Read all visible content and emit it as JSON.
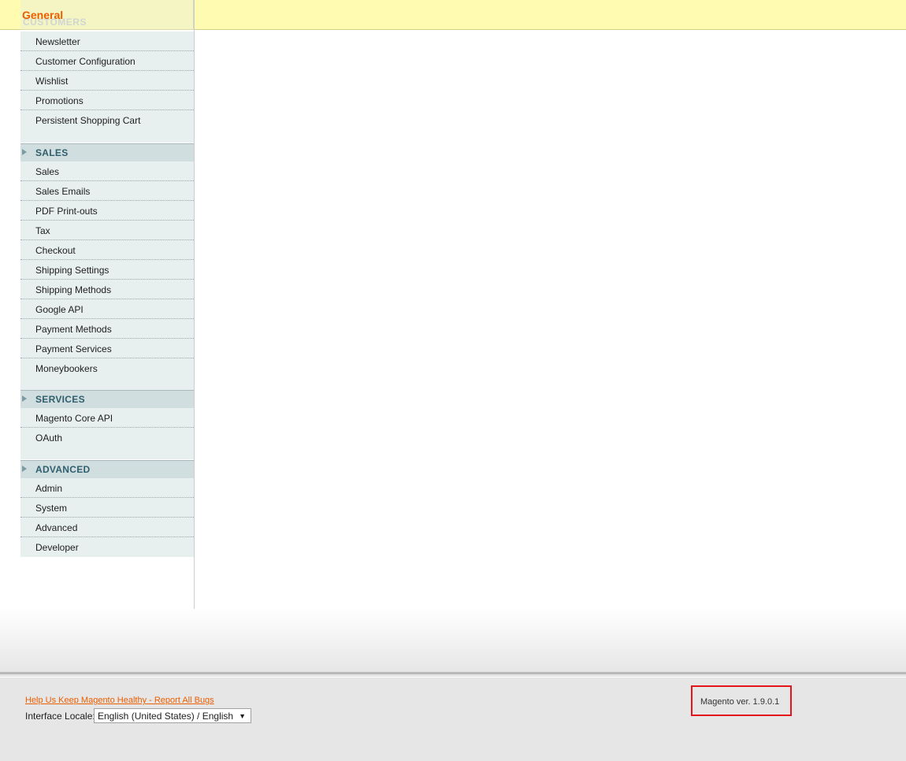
{
  "header": {
    "title": "General"
  },
  "sidebar": {
    "ghost_heading": "CUSTOMERS",
    "customers_items": [
      "Newsletter",
      "Customer Configuration",
      "Wishlist",
      "Promotions",
      "Persistent Shopping Cart"
    ],
    "sections": [
      {
        "label": "SALES",
        "items": [
          "Sales",
          "Sales Emails",
          "PDF Print-outs",
          "Tax",
          "Checkout",
          "Shipping Settings",
          "Shipping Methods",
          "Google API",
          "Payment Methods",
          "Payment Services",
          "Moneybookers"
        ]
      },
      {
        "label": "SERVICES",
        "items": [
          "Magento Core API",
          "OAuth"
        ]
      },
      {
        "label": "ADVANCED",
        "items": [
          "Admin",
          "System",
          "Advanced",
          "Developer"
        ]
      }
    ]
  },
  "footer": {
    "report_link": "Help Us Keep Magento Healthy - Report All Bugs",
    "locale_label": "Interface Locale:",
    "locale_value": "English (United States) / English",
    "version": "Magento ver. 1.9.0.1"
  },
  "colors": {
    "accent": "#eb5e00",
    "topbar": "#fffbb0",
    "highlight": "#e8141b"
  }
}
